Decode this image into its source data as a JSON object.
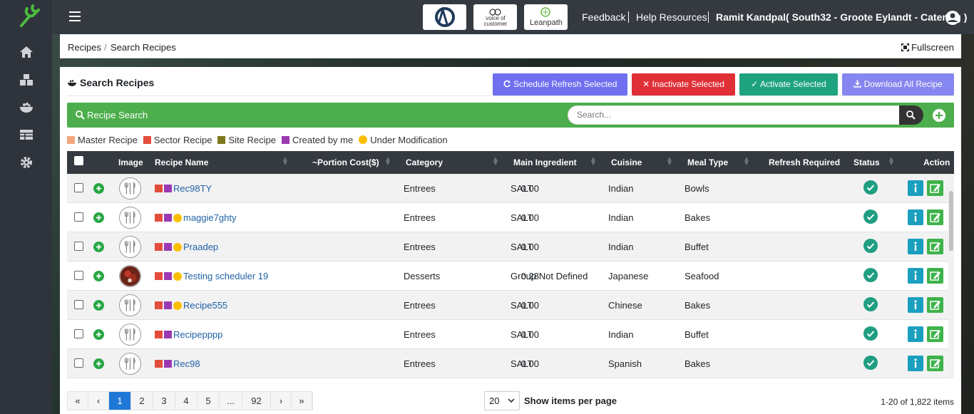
{
  "topbar": {
    "links": [
      "Feedback",
      "Help Resources",
      "Ramit Kandpal( South32 - Groote Eylandt - Catering )"
    ],
    "brands": [
      "voice of customer",
      "Leanpath"
    ]
  },
  "breadcrumb": [
    "Recipes",
    "/",
    "Search Recipes"
  ],
  "fullscreen": "Fullscreen",
  "panel": {
    "title": "Search Recipes"
  },
  "actions": [
    "Schedule Refresh Selected",
    "Inactivate Selected",
    "Activate Selected",
    "Download All Recipe"
  ],
  "action_colors": [
    "#6f6ff0",
    "#e02f37",
    "#1fa37f",
    "#8686f0"
  ],
  "search": {
    "title": "Recipe Search",
    "placeholder": "Search..."
  },
  "legend": [
    {
      "label": "Master Recipe",
      "color": "#f5a77e",
      "shape": "square"
    },
    {
      "label": "Sector Recipe",
      "color": "#e34d3b",
      "shape": "square"
    },
    {
      "label": "Site Recipe",
      "color": "#7d7a1b",
      "shape": "square"
    },
    {
      "label": "Created by me",
      "color": "#9b39b3",
      "shape": "square"
    },
    {
      "label": "Under Modification",
      "color": "#fbbf00",
      "shape": "dot"
    }
  ],
  "table": {
    "headers": [
      "Image",
      "Recipe Name",
      "~Portion Cost($)",
      "Category",
      "Main Ingredient",
      "Cuisine",
      "Meal Type",
      "Refresh Required",
      "Status",
      "Action"
    ],
    "rows": [
      {
        "name": "Rec98TY",
        "cost": "0.00",
        "category": "Entrees",
        "ingredient": "SALT",
        "cuisine": "Indian",
        "meal": "Bowls",
        "dot": false,
        "photo": false
      },
      {
        "name": "maggie7ghty",
        "cost": "0.00",
        "category": "Entrees",
        "ingredient": "SALT",
        "cuisine": "Indian",
        "meal": "Bakes",
        "dot": true,
        "photo": false
      },
      {
        "name": "Praadep",
        "cost": "0.00",
        "category": "Entrees",
        "ingredient": "SALT",
        "cuisine": "Indian",
        "meal": "Buffet",
        "dot": true,
        "photo": false
      },
      {
        "name": "Testing scheduler 19",
        "cost": "0.28",
        "category": "Desserts",
        "ingredient": "Group Not Defined",
        "cuisine": "Japanese",
        "meal": "Seafood",
        "dot": true,
        "photo": true
      },
      {
        "name": "Recipe555",
        "cost": "0.00",
        "category": "Entrees",
        "ingredient": "SALT",
        "cuisine": "Chinese",
        "meal": "Bakes",
        "dot": true,
        "photo": false
      },
      {
        "name": "Recipepppp",
        "cost": "0.00",
        "category": "Entrees",
        "ingredient": "SALT",
        "cuisine": "Indian",
        "meal": "Buffet",
        "dot": false,
        "photo": false
      },
      {
        "name": "Rec98",
        "cost": "0.00",
        "category": "Entrees",
        "ingredient": "SALT",
        "cuisine": "Spanish",
        "meal": "Bakes",
        "dot": false,
        "photo": false
      }
    ]
  },
  "pagination": {
    "pages": [
      "«",
      "‹",
      "1",
      "2",
      "3",
      "4",
      "5",
      "...",
      "92",
      "›",
      "»"
    ],
    "active": "1",
    "per_page": "20",
    "per_page_label": "Show items per page",
    "total": "1-20 of 1,822 items"
  }
}
